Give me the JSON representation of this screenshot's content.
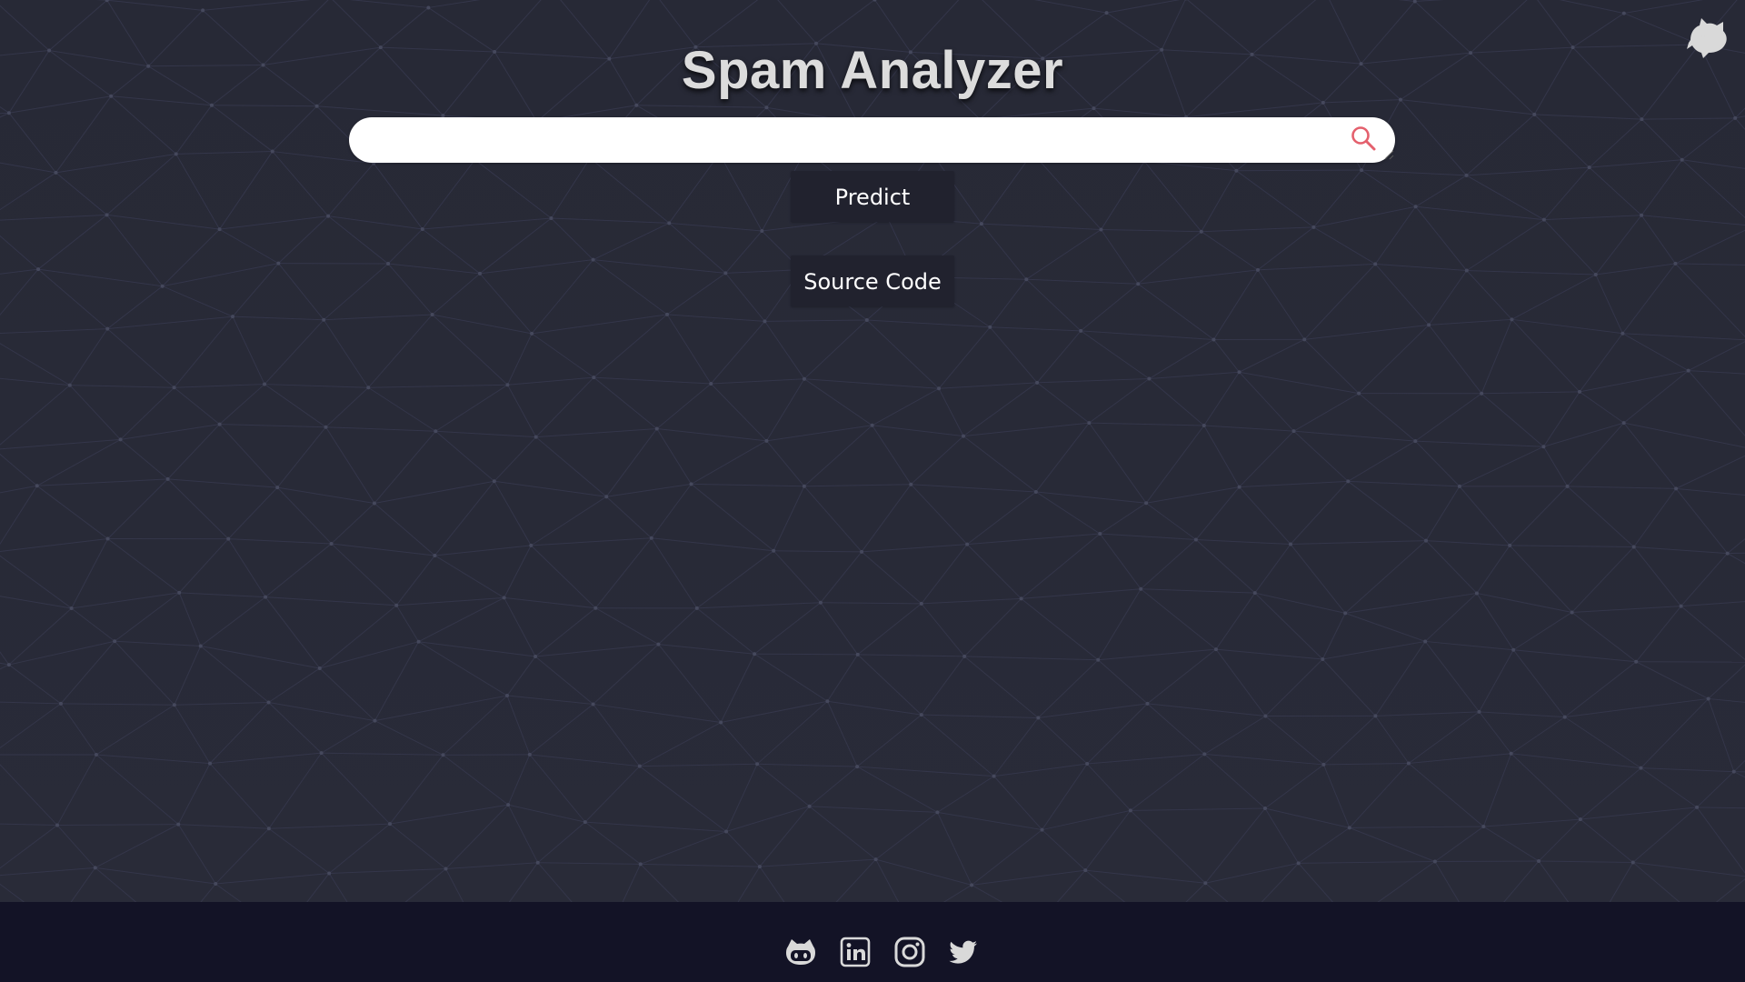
{
  "page": {
    "title": "Spam Analyzer"
  },
  "search": {
    "value": "",
    "placeholder": "",
    "icon": "search-icon"
  },
  "buttons": {
    "predict_label": "Predict",
    "source_label": "Source Code"
  },
  "corner_logo": {
    "icon": "octocat-icon"
  },
  "footer": {
    "icons": [
      "github-icon",
      "linkedin-icon",
      "instagram-icon",
      "twitter-icon"
    ]
  },
  "colors": {
    "background": "#282a36",
    "footer": "#131326",
    "button": "#21222e",
    "search_icon": "#e4606d",
    "title": "#dcdcdc",
    "icons": "#d9d9d9"
  }
}
